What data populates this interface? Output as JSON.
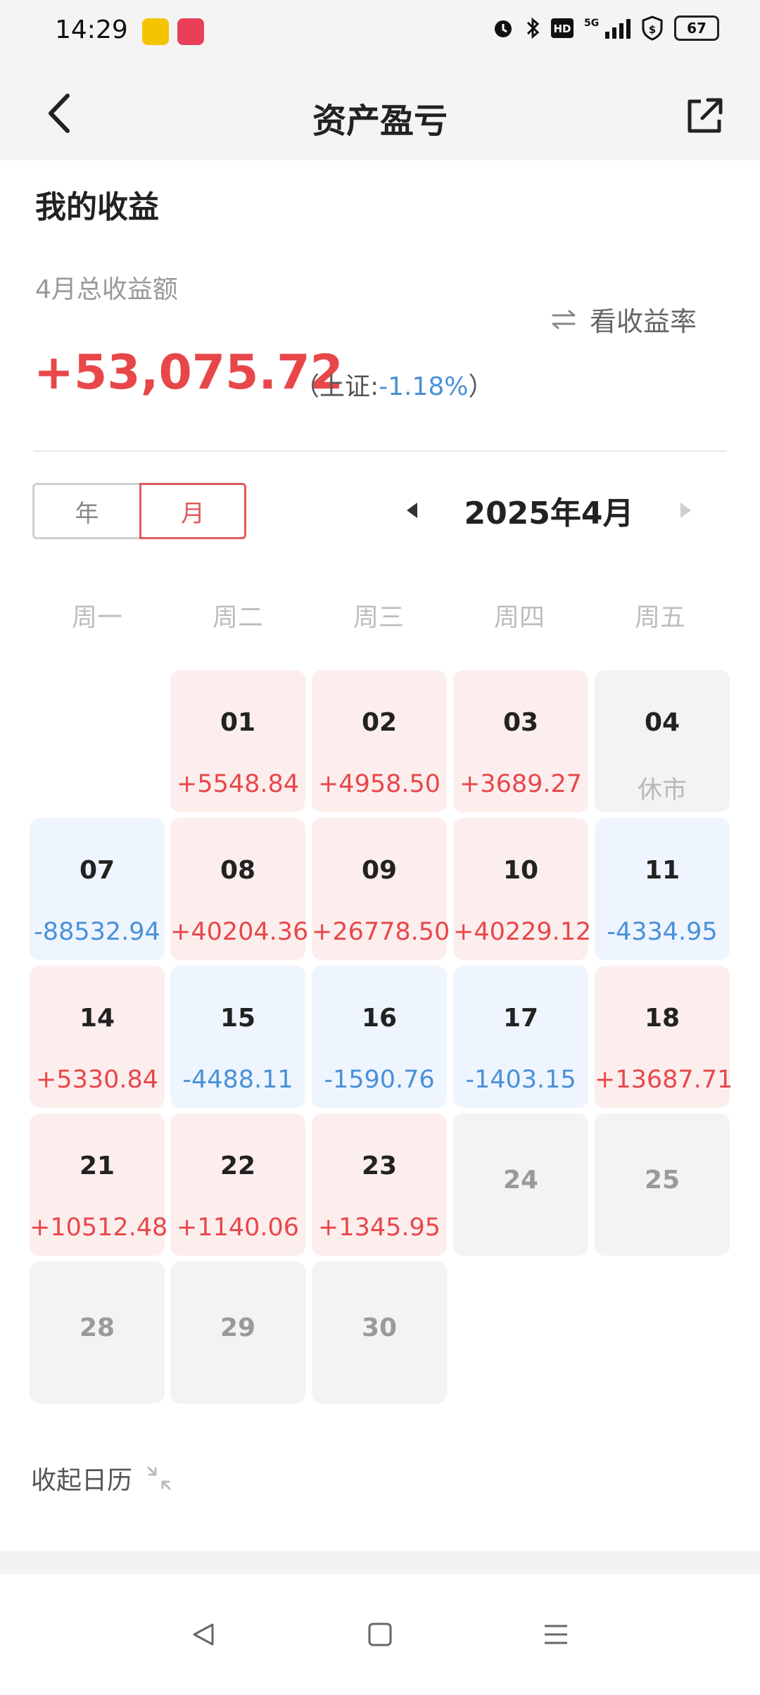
{
  "status_bar": {
    "time": "14:29",
    "battery": "67"
  },
  "nav": {
    "title": "资产盈亏"
  },
  "summary": {
    "title": "我的收益",
    "label": "4月总收益额",
    "toggle_label": "看收益率",
    "total": "+53,075.72",
    "index_prefix": "（上证:",
    "index_value": "-1.18%",
    "index_suffix": "）"
  },
  "segment": {
    "year": "年",
    "month": "月",
    "selected": "月"
  },
  "calendar": {
    "month_label": "2025年4月",
    "weekdays": [
      "周一",
      "周二",
      "周三",
      "周四",
      "周五"
    ],
    "days": [
      {
        "day": "01",
        "value": "+5548.84",
        "status": "pos"
      },
      {
        "day": "02",
        "value": "+4958.50",
        "status": "pos"
      },
      {
        "day": "03",
        "value": "+3689.27",
        "status": "pos"
      },
      {
        "day": "04",
        "value": "休市",
        "status": "closed"
      },
      {
        "day": "07",
        "value": "-88532.94",
        "status": "neg"
      },
      {
        "day": "08",
        "value": "+40204.36",
        "status": "pos"
      },
      {
        "day": "09",
        "value": "+26778.50",
        "status": "pos"
      },
      {
        "day": "10",
        "value": "+40229.12",
        "status": "pos"
      },
      {
        "day": "11",
        "value": "-4334.95",
        "status": "neg"
      },
      {
        "day": "14",
        "value": "+5330.84",
        "status": "pos"
      },
      {
        "day": "15",
        "value": "-4488.11",
        "status": "neg"
      },
      {
        "day": "16",
        "value": "-1590.76",
        "status": "neg"
      },
      {
        "day": "17",
        "value": "-1403.15",
        "status": "neg"
      },
      {
        "day": "18",
        "value": "+13687.71",
        "status": "pos"
      },
      {
        "day": "21",
        "value": "+10512.48",
        "status": "pos"
      },
      {
        "day": "22",
        "value": "+1140.06",
        "status": "pos"
      },
      {
        "day": "23",
        "value": "+1345.95",
        "status": "pos"
      },
      {
        "day": "24",
        "value": "",
        "status": "future"
      },
      {
        "day": "25",
        "value": "",
        "status": "future"
      },
      {
        "day": "28",
        "value": "",
        "status": "future"
      },
      {
        "day": "29",
        "value": "",
        "status": "future"
      },
      {
        "day": "30",
        "value": "",
        "status": "future"
      }
    ]
  },
  "collapse_label": "收起日历",
  "colors": {
    "profit": "#e8474a",
    "loss": "#4a90d9"
  }
}
